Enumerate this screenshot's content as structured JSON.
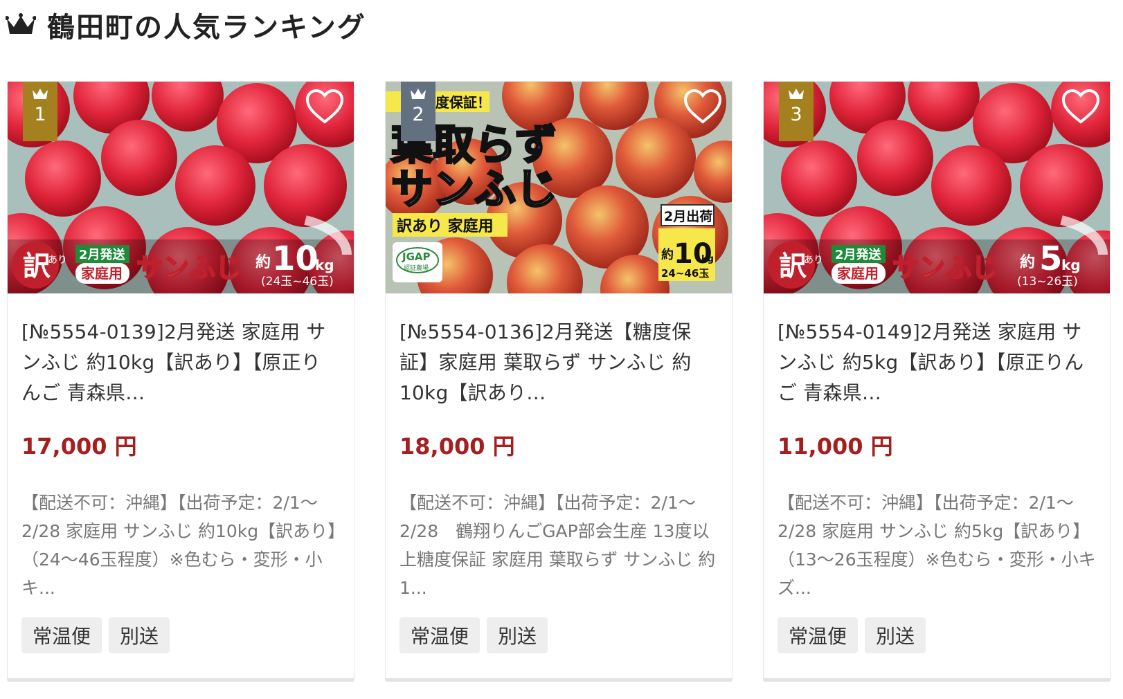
{
  "ranking": {
    "title": "鶴田町の人気ランキング",
    "icon": "crown-icon"
  },
  "colors": {
    "gold_badge": "#a5801f",
    "silver_badge": "#627080",
    "price_red": "#a51f1f",
    "tag_bg": "#eeeeee"
  },
  "products": [
    {
      "rank": "1",
      "title": "[№5554-0139]2月発送 家庭用 サンふじ 約10kg【訳あり】【原正りんご 青森県…",
      "price": "17,000 円",
      "description": "【配送不可：沖縄】【出荷予定：2/1～2/28 家庭用 サンふじ 約10kg【訳あり】（24～46玉程度）※色むら・変形・小キ...",
      "tags": [
        "常温便",
        "別送"
      ],
      "image_text": {
        "wake": "訳",
        "ari": "あり",
        "ship": "2月発送",
        "home": "家庭用",
        "name": "サンふじ",
        "approx": "約",
        "weight": "10",
        "unit": "kg",
        "count": "(24玉~46玉)"
      }
    },
    {
      "rank": "2",
      "title": "[№5554-0136]2月発送【糖度保証】家庭用 葉取らず サンふじ 約10kg【訳あり…",
      "price": "18,000 円",
      "description": "【配送不可：沖縄】【出荷予定：2/1～2/28　鶴翔りんごGAP部会生産 13度以上糖度保証 家庭用 葉取らず サンふじ 約1...",
      "tags": [
        "常温便",
        "別送"
      ],
      "image_text": {
        "banner": "度保証！",
        "line1": "葉取らず",
        "line2": "サンふじ",
        "label": "訳あり 家庭用",
        "gap": "JGAP",
        "gap_sub": "認証農場",
        "ship": "2月出荷",
        "approx": "約",
        "weight": "10",
        "unit": "kg",
        "count": "24~46玉"
      }
    },
    {
      "rank": "3",
      "title": "[№5554-0149]2月発送 家庭用 サンふじ 約5kg【訳あり】【原正りんご 青森県…",
      "price": "11,000 円",
      "description": "【配送不可：沖縄】【出荷予定：2/1～2/28 家庭用 サンふじ 約5kg【訳あり】（13～26玉程度）※色むら・変形・小キズ...",
      "tags": [
        "常温便",
        "別送"
      ],
      "image_text": {
        "wake": "訳",
        "ari": "あり",
        "ship": "2月発送",
        "home": "家庭用",
        "name": "サンふじ",
        "approx": "約",
        "weight": "5",
        "unit": "kg",
        "count": "(13~26玉)"
      }
    }
  ]
}
